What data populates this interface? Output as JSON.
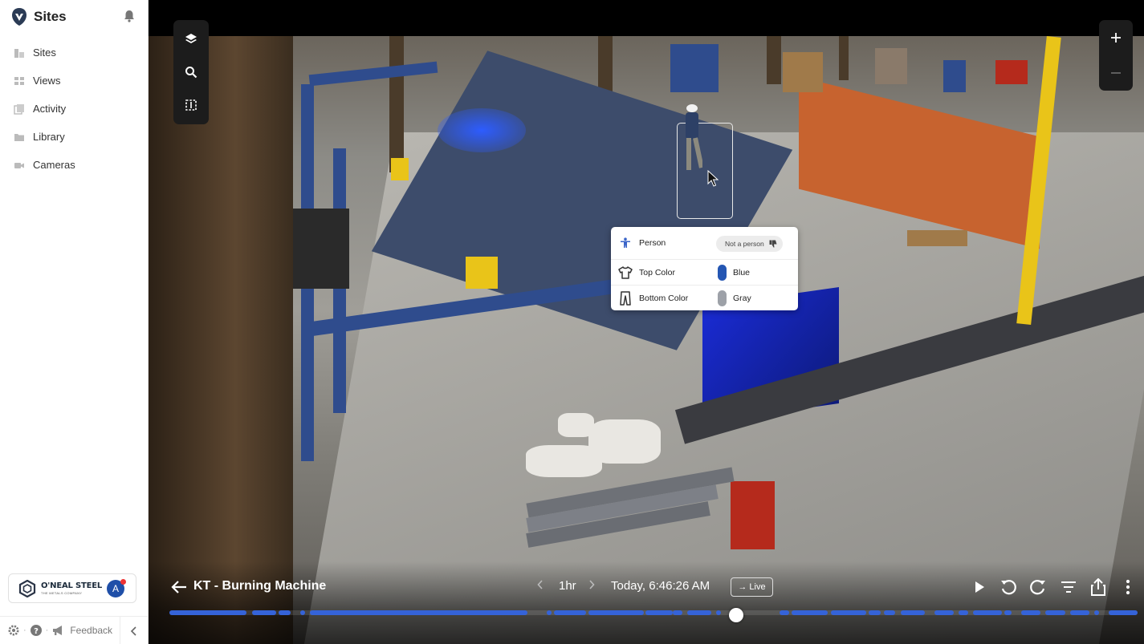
{
  "sidebar": {
    "title": "Sites",
    "nav": [
      {
        "label": "Sites",
        "icon": "sites-icon"
      },
      {
        "label": "Views",
        "icon": "views-icon"
      },
      {
        "label": "Activity",
        "icon": "activity-icon"
      },
      {
        "label": "Library",
        "icon": "folder-icon"
      },
      {
        "label": "Cameras",
        "icon": "camera-icon"
      }
    ],
    "company": {
      "name": "O'NEAL STEEL",
      "subtitle": "THE METALS COMPANY",
      "avatar_initial": "A"
    },
    "footer": {
      "feedback_label": "Feedback",
      "separator": "·"
    }
  },
  "viewer": {
    "camera_title": "KT - Burning Machine",
    "range": "1hr",
    "timestamp": "Today, 6:46:26 AM",
    "live_label": "→ Live",
    "playhead_position": 0.585,
    "recorded_segments": [
      [
        0.0,
        0.08
      ],
      [
        0.085,
        0.11
      ],
      [
        0.113,
        0.125
      ],
      [
        0.135,
        0.14
      ],
      [
        0.145,
        0.37
      ],
      [
        0.39,
        0.395
      ],
      [
        0.397,
        0.43
      ],
      [
        0.433,
        0.49
      ],
      [
        0.492,
        0.52
      ],
      [
        0.52,
        0.53
      ],
      [
        0.535,
        0.56
      ],
      [
        0.565,
        0.57
      ],
      [
        0.63,
        0.64
      ],
      [
        0.643,
        0.68
      ],
      [
        0.683,
        0.72
      ],
      [
        0.722,
        0.735
      ],
      [
        0.738,
        0.75
      ],
      [
        0.755,
        0.78
      ],
      [
        0.79,
        0.81
      ],
      [
        0.815,
        0.825
      ],
      [
        0.83,
        0.86
      ],
      [
        0.862,
        0.87
      ],
      [
        0.88,
        0.9
      ],
      [
        0.905,
        0.925
      ],
      [
        0.93,
        0.95
      ],
      [
        0.955,
        0.96
      ],
      [
        0.97,
        1.0
      ]
    ]
  },
  "detection": {
    "class_label": "Person",
    "reject_label": "Not a person",
    "attributes": [
      {
        "label": "Top Color",
        "value": "Blue",
        "swatch": "#2456b3",
        "icon": "shirt-icon"
      },
      {
        "label": "Bottom Color",
        "value": "Gray",
        "swatch": "#9da1a8",
        "icon": "pants-icon"
      }
    ]
  },
  "colors": {
    "accent": "#3563d8",
    "panel_bg": "#1c1c1c"
  }
}
